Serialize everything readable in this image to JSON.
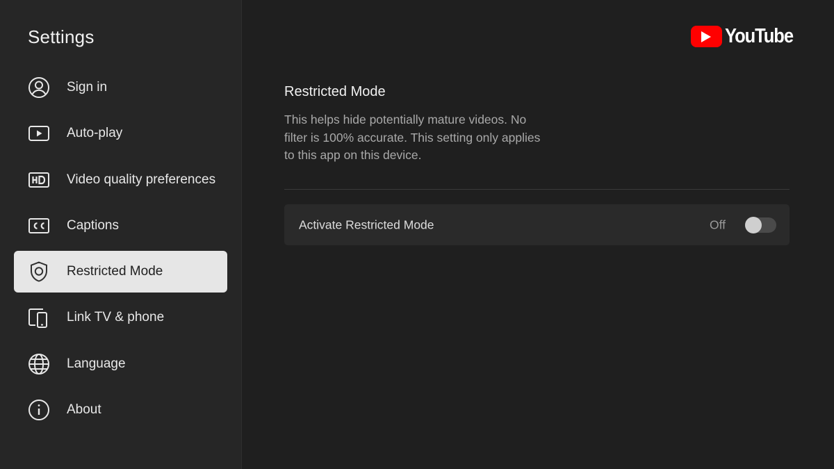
{
  "sidebar": {
    "title": "Settings",
    "items": [
      {
        "label": "Sign in",
        "icon": "account-icon"
      },
      {
        "label": "Auto-play",
        "icon": "autoplay-icon"
      },
      {
        "label": "Video quality preferences",
        "icon": "hd-icon"
      },
      {
        "label": "Captions",
        "icon": "cc-icon"
      },
      {
        "label": "Restricted Mode",
        "icon": "shield-icon",
        "selected": true
      },
      {
        "label": "Link TV & phone",
        "icon": "devices-icon"
      },
      {
        "label": "Language",
        "icon": "globe-icon"
      },
      {
        "label": "About",
        "icon": "info-icon"
      }
    ]
  },
  "brand": {
    "name": "YouTube",
    "accent": "#ff0000"
  },
  "main": {
    "title": "Restricted Mode",
    "description": "This helps hide potentially mature videos. No filter is 100% accurate. This setting only applies to this app on this device.",
    "setting": {
      "label": "Activate Restricted Mode",
      "value": "Off",
      "enabled": false
    }
  }
}
